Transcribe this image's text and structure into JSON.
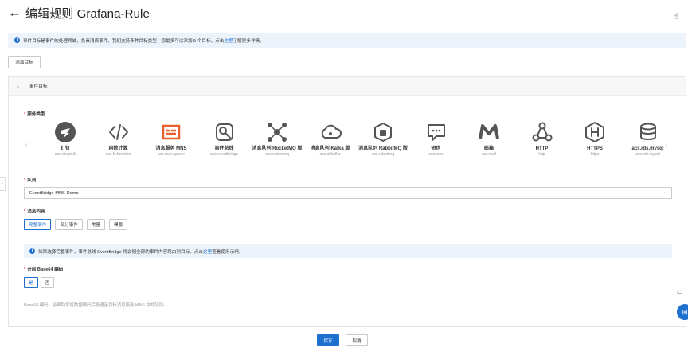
{
  "header": {
    "back_icon": "←",
    "title": "编辑规则 Grafana-Rule",
    "help_icon": "☝"
  },
  "info": {
    "text": "事件目标是事件的处理终端，负责消费事件。我们支持多种目标类型，您最多可以添加 5 个目标。点击",
    "link": "这里",
    "suffix": "了解更多详情。"
  },
  "add_target_label": "添加目标",
  "panel": {
    "title": "事件目标",
    "service_type_label": "服务类型",
    "services": [
      {
        "name": "钉钉",
        "code": "acs.dingtalk",
        "icon": "dingtalk-icon",
        "color": "#555"
      },
      {
        "name": "函数计算",
        "code": "acs.fc.function",
        "icon": "function-icon",
        "color": "#555"
      },
      {
        "name": "消息服务 MNS",
        "code": "acs.mns.queue",
        "icon": "mns-icon",
        "color": "#e8612c"
      },
      {
        "name": "事件总线",
        "code": "acs.eventbridge",
        "icon": "eventbridge-icon",
        "color": "#555"
      },
      {
        "name": "消息队列 RocketMQ 版",
        "code": "acs.rocketmq",
        "icon": "rocketmq-icon",
        "color": "#555"
      },
      {
        "name": "消息队列 Kafka 版",
        "code": "acs.alikafka",
        "icon": "kafka-icon",
        "color": "#555"
      },
      {
        "name": "消息队列 RabbitMQ 版",
        "code": "acs.rabbitmq",
        "icon": "rabbitmq-icon",
        "color": "#555"
      },
      {
        "name": "短信",
        "code": "acs.sms",
        "icon": "sms-icon",
        "color": "#555"
      },
      {
        "name": "邮箱",
        "code": "acs.mail",
        "icon": "mail-icon",
        "color": "#555"
      },
      {
        "name": "HTTP",
        "code": "http",
        "icon": "http-icon",
        "color": "#555"
      },
      {
        "name": "HTTPS",
        "code": "https",
        "icon": "https-icon",
        "color": "#555"
      },
      {
        "name": "acs.rds.mysql",
        "code": "acs.rds.mysql",
        "icon": "rds-icon",
        "color": "#555"
      }
    ],
    "queue_label": "队列",
    "queue_value": "EventBridge-MNS-Demo",
    "content_label": "消息内容",
    "content_options": [
      "完整事件",
      "部分事件",
      "常量",
      "模版"
    ],
    "content_selected": 0,
    "tip": {
      "text": "如果选择完整事件，事件总线 EventBridge 将会把全部的事件内容路由到目标。点击",
      "link": "这里",
      "suffix": "查看使用示例。"
    },
    "base64_label": "开启 Base64 编码",
    "base64_options": [
      "是",
      "否"
    ],
    "base64_selected": 0,
    "base64_hint": "Base64 编码，会帮助您将数据编码后投递至目标消息服务 MNS 中的队列。"
  },
  "footer": {
    "save": "保存",
    "cancel": "取消"
  },
  "colors": {
    "primary": "#1f6fd1",
    "required": "#d9363e",
    "mns": "#e8612c"
  }
}
